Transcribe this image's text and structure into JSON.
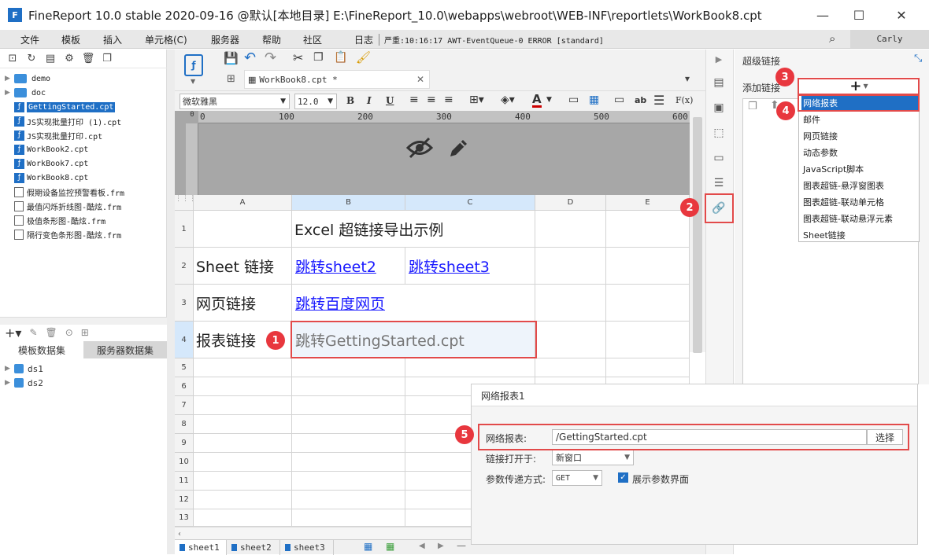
{
  "window": {
    "title": "FineReport 10.0 stable 2020-09-16 @默认[本地目录]    E:\\FineReport_10.0\\webapps\\webroot\\WEB-INF\\reportlets\\WorkBook8.cpt",
    "minimize": "—",
    "maximize": "☐",
    "close": "✕"
  },
  "menubar": {
    "items": [
      "文件",
      "模板",
      "插入",
      "单元格(C)",
      "服务器",
      "帮助",
      "社区"
    ],
    "log_label": "日志",
    "log_message": "严重:10:16:17 AWT-EventQueue-0 ERROR [standard]",
    "user": "Carly"
  },
  "file_tree": {
    "items": [
      {
        "name": "demo",
        "type": "folder"
      },
      {
        "name": "doc",
        "type": "folder"
      },
      {
        "name": "GettingStarted.cpt",
        "type": "cpt",
        "selected": true
      },
      {
        "name": "JS实现批量打印 (1).cpt",
        "type": "cpt"
      },
      {
        "name": "JS实现批量打印.cpt",
        "type": "cpt"
      },
      {
        "name": "WorkBook2.cpt",
        "type": "cpt"
      },
      {
        "name": "WorkBook7.cpt",
        "type": "cpt"
      },
      {
        "name": "WorkBook8.cpt",
        "type": "cpt"
      },
      {
        "name": "假期设备监控预警看板.frm",
        "type": "frm"
      },
      {
        "name": "最值闪烁折线图-酷炫.frm",
        "type": "frm"
      },
      {
        "name": "极值条形图-酷炫.frm",
        "type": "frm"
      },
      {
        "name": "隔行变色条形图-酷炫.frm",
        "type": "frm"
      }
    ]
  },
  "dataset_panel": {
    "tab_template": "模板数据集",
    "tab_server": "服务器数据集",
    "datasets": [
      "ds1",
      "ds2"
    ]
  },
  "editor": {
    "tab_name": "WorkBook8.cpt *",
    "font_name": "微软雅黑",
    "font_size": "12.0",
    "ruler_marks": [
      "0",
      "100",
      "200",
      "300",
      "400",
      "500",
      "600"
    ],
    "columns": [
      "A",
      "B",
      "C",
      "D",
      "E"
    ],
    "rows": [
      "1",
      "2",
      "3",
      "4",
      "5",
      "6",
      "7",
      "8",
      "9",
      "10",
      "11",
      "12",
      "13"
    ],
    "cells": {
      "b1": "Excel 超链接导出示例",
      "a2": "Sheet 链接",
      "b2": "跳转sheet2",
      "c2": "跳转sheet3",
      "a3": "网页链接",
      "b3": "跳转百度网页",
      "a4": "报表链接",
      "b4": "跳转GettingStarted.cpt"
    },
    "sheets": [
      "sheet1",
      "sheet2",
      "sheet3"
    ]
  },
  "hyperlink_panel": {
    "title": "超级链接",
    "add_label": "添加链接",
    "add_button": "+",
    "menu_items": [
      "网络报表",
      "邮件",
      "网页链接",
      "动态参数",
      "JavaScript脚本",
      "图表超链-悬浮窗图表",
      "图表超链-联动单元格",
      "图表超链-联动悬浮元素",
      "Sheet链接"
    ]
  },
  "link_editor": {
    "title": "网络报表1",
    "report_label": "网络报表:",
    "report_value": "/GettingStarted.cpt",
    "choose_button": "选择",
    "open_in_label": "链接打开于:",
    "open_in_value": "新窗口",
    "param_method_label": "参数传递方式:",
    "param_method_value": "GET",
    "show_param_label": "展示参数界面",
    "show_param_checked": true
  },
  "annotations": [
    "1",
    "2",
    "3",
    "4",
    "5"
  ],
  "colors": {
    "accent": "#1f6fc5",
    "annotation_red": "#e8373e",
    "link_blue": "#1a1aff",
    "selection": "#d5e8fb"
  }
}
